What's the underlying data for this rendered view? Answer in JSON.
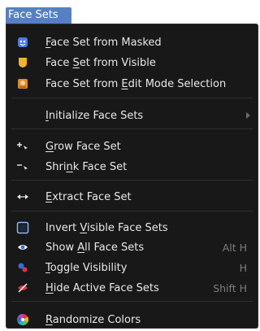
{
  "tab": {
    "label": "Face Sets"
  },
  "menu": {
    "items": [
      {
        "pre": "",
        "key": "F",
        "post": "ace Set from Masked",
        "shortcut": "",
        "icon": "face-mask-icon"
      },
      {
        "pre": "Face ",
        "key": "S",
        "post": "et from Visible",
        "shortcut": "",
        "icon": "shield-icon"
      },
      {
        "pre": "Face Set from ",
        "key": "E",
        "post": "dit Mode Selection",
        "shortcut": "",
        "icon": "edit-selection-icon"
      },
      {
        "pre": "",
        "key": "I",
        "post": "nitialize Face Sets",
        "shortcut": "",
        "icon": ""
      },
      {
        "pre": "",
        "key": "G",
        "post": "row Face Set",
        "shortcut": "",
        "icon": "grow-icon"
      },
      {
        "pre": "Shri",
        "key": "n",
        "post": "k Face Set",
        "shortcut": "",
        "icon": "shrink-icon"
      },
      {
        "pre": "",
        "key": "E",
        "post": "xtract Face Set",
        "shortcut": "",
        "icon": "extract-icon"
      },
      {
        "pre": "Invert ",
        "key": "V",
        "post": "isible Face Sets",
        "shortcut": "",
        "icon": "invert-icon"
      },
      {
        "pre": "Show ",
        "key": "A",
        "post": "ll Face Sets",
        "shortcut": "Alt H",
        "icon": "eye-icon"
      },
      {
        "pre": "",
        "key": "T",
        "post": "oggle Visibility",
        "shortcut": "H",
        "icon": "toggle-visibility-icon"
      },
      {
        "pre": "",
        "key": "H",
        "post": "ide Active Face Sets",
        "shortcut": "Shift H",
        "icon": "hide-icon"
      },
      {
        "pre": "",
        "key": "R",
        "post": "andomize Colors",
        "shortcut": "",
        "icon": "color-wheel-icon"
      }
    ]
  }
}
